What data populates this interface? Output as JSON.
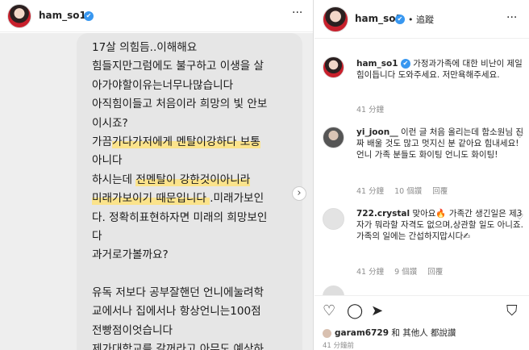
{
  "post": {
    "username": "ham_so1",
    "verified_mark": "✔",
    "more": "···",
    "message_lines": [
      {
        "text": "17살 의힘듬..이해해요",
        "highlight": ""
      },
      {
        "text": "힘들지만그럼에도 불구하고  이생을 살",
        "highlight": ""
      },
      {
        "text": "아가야할이유는너무나많습니다",
        "highlight": ""
      },
      {
        "text": " 아직힘이들고 처음이라 희망의 빛 안보",
        "highlight": ""
      },
      {
        "text": "이시죠?",
        "highlight": ""
      },
      {
        "pre": "가끔",
        "hl": "가다가저에게 멘탈이강하다 보통",
        "post": ""
      },
      {
        "text": "아니다",
        "highlight": ""
      },
      {
        "pre": "하시는데 ",
        "hl": "전멘탈이 강한것이아니라",
        "post": ""
      },
      {
        "pre": "",
        "hl": "미래가보이기 때문입니다 ",
        "post": ".미래가보인"
      },
      {
        "text": "다.  정확히표현하자면 미래의 희망보인",
        "highlight": ""
      },
      {
        "text": "다",
        "highlight": ""
      },
      {
        "text": "과거로가볼까요?",
        "highlight": ""
      },
      {
        "text": "",
        "highlight": ""
      },
      {
        "text": "유독 저보다 공부잘핸던 언니에눌려학",
        "highlight": ""
      },
      {
        "text": "교에서나 집에서나 항상언니는100점",
        "highlight": ""
      },
      {
        "text": "전빵점이엇습니다",
        "highlight": ""
      },
      {
        "text": " 제가대학교를 갈꺼라고 아무도 예상하",
        "highlight": ""
      }
    ],
    "next_arrow": "›"
  },
  "sidebar": {
    "username": "ham_so1",
    "follow_text": "• 追蹤",
    "more": "···",
    "comments": [
      {
        "username": "ham_so1",
        "text": "가정과가족에 대한 비난이 제일 힘이듭니다 도와주세요. 저만욕해주세요.",
        "time": "41 分鐘",
        "likes": "",
        "reply": ""
      },
      {
        "username": "yi_joon__",
        "text": "이런 글 처음 올리는데 함소원님 진짜 배울 것도 많고 멋지신 분 같아요 힘내세요! 언니 가족 분들도 화이팅 언니도 화이팅!",
        "time": "41 分鐘",
        "likes": "10 個讚",
        "reply": "回覆"
      },
      {
        "username": "722.crystal",
        "text": "맞아요🔥 가족간 생긴일은 제3자가 뭐라할 자격도 없으며,상관할 일도 아니죠. 가족의 일에는 간섭하지맙시다✍",
        "time": "41 分鐘",
        "likes": "9 個讚",
        "reply": "回覆"
      }
    ],
    "actions": {
      "heart": "♡",
      "comment": "◯",
      "share": "➤",
      "bookmark": "⛉"
    },
    "likes_user": "garam6729",
    "likes_rest": " 和 其他人 都說讚",
    "time_ago": "41 分鐘前"
  },
  "colors": {
    "highlight": "#fbe38b",
    "verified": "#3897f0",
    "meta_gray": "#8e8e8e"
  }
}
